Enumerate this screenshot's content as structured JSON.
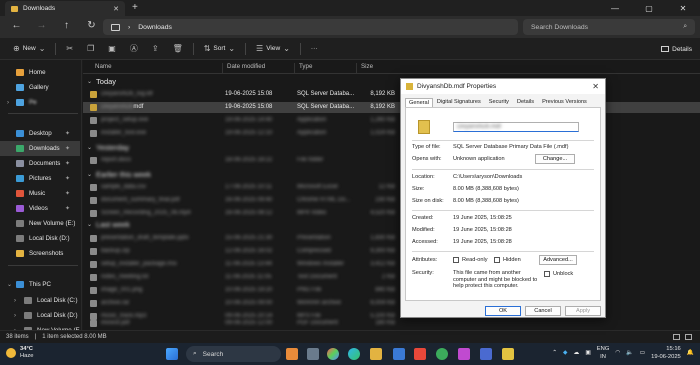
{
  "window": {
    "tab_title": "Downloads",
    "new_tab": "+",
    "controls": [
      "—",
      "▢",
      "✕"
    ]
  },
  "nav": {
    "back": "←",
    "forward": "→",
    "up": "↑",
    "refresh": "↻",
    "breadcrumb_sep": "›",
    "location": "Downloads",
    "search_placeholder": "Search Downloads"
  },
  "commands": {
    "new": "New",
    "sort": "Sort",
    "view": "View",
    "more": "···",
    "details": "Details"
  },
  "sidebar": {
    "items": [
      {
        "label": "Home",
        "color": "#e6a03c"
      },
      {
        "label": "Gallery",
        "color": "#4ea3e0"
      },
      {
        "label": "Pe",
        "color": "#4ea3e0"
      },
      {
        "label": "Desktop",
        "color": "#3b8fd6"
      },
      {
        "label": "Downloads",
        "color": "#3ba86a"
      },
      {
        "label": "Documents",
        "color": "#8a8fa0"
      },
      {
        "label": "Pictures",
        "color": "#3b9bd6"
      },
      {
        "label": "Music",
        "color": "#e0553b"
      },
      {
        "label": "Videos",
        "color": "#9b5bd6"
      },
      {
        "label": "New Volume (E:)",
        "color": "#7c7c7c"
      },
      {
        "label": "Local Disk (D:)",
        "color": "#7c7c7c"
      },
      {
        "label": "Screenshots",
        "color": "#e3b341"
      },
      {
        "label": "This PC",
        "color": "#3b8fd6"
      },
      {
        "label": "Local Disk (C:)",
        "color": "#7c7c7c"
      },
      {
        "label": "Local Disk (D:)",
        "color": "#7c7c7c"
      },
      {
        "label": "New Volume (E:)",
        "color": "#7c7c7c"
      }
    ]
  },
  "columns": [
    "Name",
    "Date modified",
    "Type",
    "Size"
  ],
  "groups": [
    "Today",
    "Yesterday",
    "Earlier this week",
    "Last week"
  ],
  "rows": [
    {
      "name": "DivyanshDb_log.ldf",
      "date": "19-06-2025 15:08",
      "type": "SQL Server Databa...",
      "size": "8,192 KB"
    },
    {
      "name": "DivyanshDb.mdf",
      "date": "19-06-2025 15:08",
      "type": "SQL Server Databa...",
      "size": "8,192 KB"
    },
    {
      "name": "project_setup.exe",
      "date": "19-06-2025 14:40",
      "type": "Application",
      "size": "1,260 KB"
    },
    {
      "name": "installer_tool.exe",
      "date": "19-06-2025 12:10",
      "type": "Application",
      "size": "1,024 KB"
    },
    {
      "name": "report.docx",
      "date": "18-06-2025 18:22",
      "type": "File folder",
      "size": ""
    },
    {
      "name": "sample_data.csv",
      "date": "17-06-2025 10:11",
      "type": "Microsoft Excel",
      "size": "12 KB"
    },
    {
      "name": "document_summary_final.pdf",
      "date": "16-06-2025 09:40",
      "type": "Chrome HTML Do...",
      "size": "230 KB"
    },
    {
      "name": "Screen_Recording_2025_06.mp4",
      "date": "16-06-2025 08:12",
      "type": "MP4 Video",
      "size": "4,520 KB"
    },
    {
      "name": "presentation_draft_template.pptx",
      "date": "15-06-2025 21:30",
      "type": "Presentation",
      "size": "1,830 KB"
    },
    {
      "name": "backup.zip",
      "date": "12-06-2025 16:02",
      "type": "Compressed",
      "size": "9,300 KB"
    },
    {
      "name": "setup_installer_package.msi",
      "date": "11-06-2025 13:44",
      "type": "Windows Installer",
      "size": "3,412 KB"
    },
    {
      "name": "notes_meeting.txt",
      "date": "11-06-2025 11:05",
      "type": "Text Document",
      "size": "2 KB"
    },
    {
      "name": "image_001.png",
      "date": "10-06-2025 19:20",
      "type": "PNG File",
      "size": "840 KB"
    },
    {
      "name": "archive.rar",
      "date": "10-06-2025 09:00",
      "type": "WinRAR archive",
      "size": "6,004 KB"
    },
    {
      "name": "music_track.mp3",
      "date": "09-06-2025 20:14",
      "type": "MP3 File",
      "size": "5,100 KB"
    },
    {
      "name": "invoice.pdf",
      "date": "09-06-2025 12:00",
      "type": "PDF Document",
      "size": "180 KB"
    },
    {
      "name": "budget.xlsx",
      "date": "08-06-2025 17:33",
      "type": "Microsoft Excel",
      "size": "46 KB"
    },
    {
      "name": "readme.md",
      "date": "08-06-2025 11:11",
      "type": "MD File",
      "size": "3 KB"
    }
  ],
  "status": {
    "count": "38 items",
    "selected": "1 item selected 8.00 MB"
  },
  "dialog": {
    "title": "DivyanshDb.mdf Properties",
    "tabs": [
      "General",
      "Digital Signatures",
      "Security",
      "Details",
      "Previous Versions"
    ],
    "file_name": "DivyanshDb.mdf",
    "type_label": "Type of file:",
    "type_value": "SQL Server Database Primary Data File (.mdf)",
    "opens_label": "Opens with:",
    "opens_value": "Unknown application",
    "change_btn": "Change...",
    "location_label": "Location:",
    "location_value": "C:\\Users\\aryson\\Downloads",
    "size_label": "Size:",
    "size_value": "8.00 MB (8,388,608 bytes)",
    "sizeondisk_label": "Size on disk:",
    "sizeondisk_value": "8.00 MB (8,388,608 bytes)",
    "created_label": "Created:",
    "created_value": "19 June 2025, 15:08:25",
    "modified_label": "Modified:",
    "modified_value": "19 June 2025, 15:08:28",
    "accessed_label": "Accessed:",
    "accessed_value": "19 June 2025, 15:08:28",
    "attributes_label": "Attributes:",
    "readonly": "Read-only",
    "hidden": "Hidden",
    "advanced_btn": "Advanced...",
    "security_label": "Security:",
    "security_text": "This file came from another computer and might be blocked to help protect this computer.",
    "unblock": "Unblock",
    "ok": "OK",
    "cancel": "Cancel",
    "apply": "Apply"
  },
  "taskbar": {
    "temp": "34°C",
    "weather": "Haze",
    "search": "Search",
    "lang1": "ENG",
    "lang2": "IN",
    "time": "15:16",
    "date": "19-06-2025"
  }
}
